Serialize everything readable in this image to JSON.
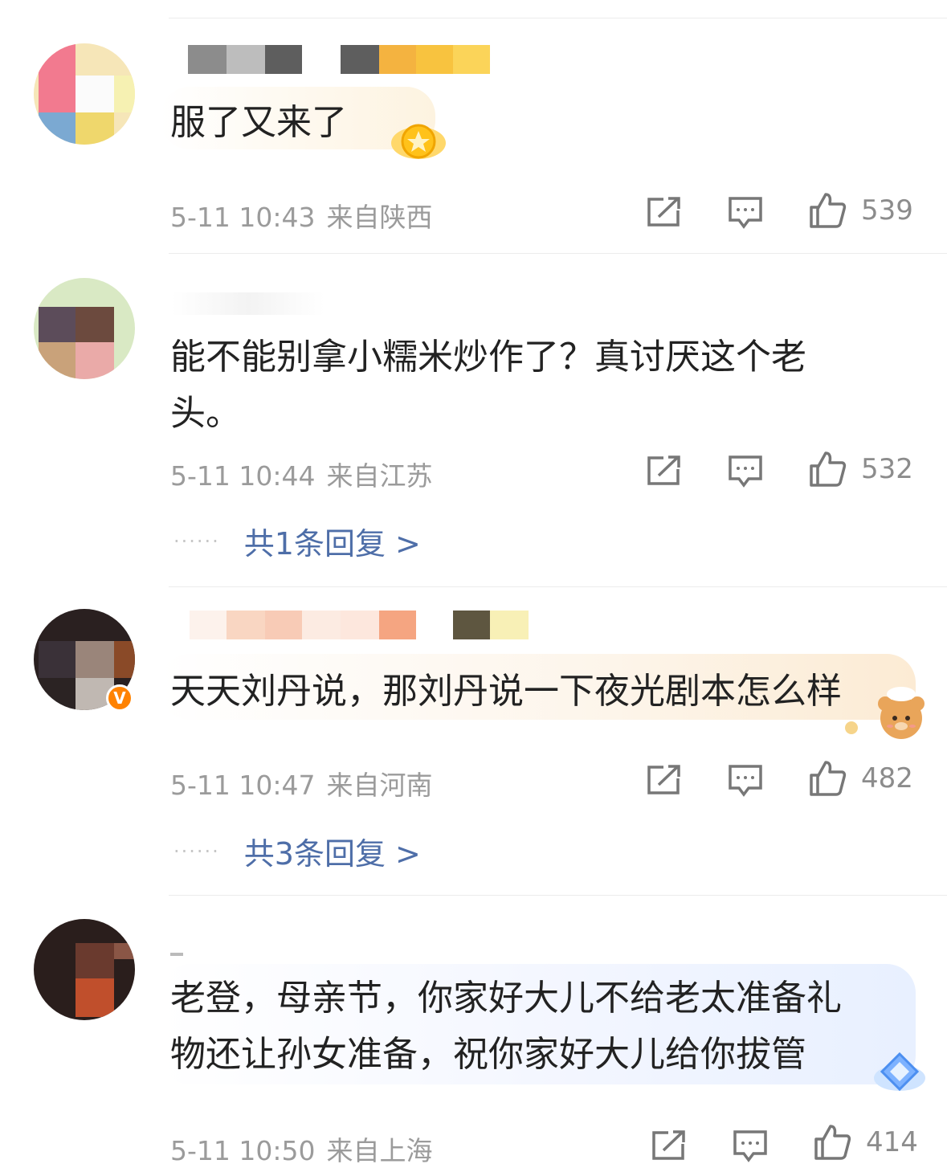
{
  "comments": [
    {
      "text": "服了又来了",
      "date": "5-11 10:43",
      "location": "来自陕西",
      "likes": "539",
      "sticker_icon": "star-badge-icon",
      "reply_link": null
    },
    {
      "text_line1": "能不能别拿小糯米炒作了？真讨厌这个老",
      "text_line2": "头。",
      "date": "5-11 10:44",
      "location": "来自江苏",
      "likes": "532",
      "reply_dots": "······",
      "reply_link": "共1条回复 >"
    },
    {
      "text": "天天刘丹说，那刘丹说一下夜光剧本怎么样",
      "date": "5-11 10:47",
      "location": "来自河南",
      "likes": "482",
      "verified_badge": "V",
      "sticker_icon": "bear-chef-icon",
      "reply_dots": "······",
      "reply_link": "共3条回复 >"
    },
    {
      "text_line1": "老登，母亲节，你家好大儿不给老太准备礼",
      "text_line2": "物还让孙女准备，祝你家好大儿给你拔管",
      "date": "5-11 10:50",
      "location": "来自上海",
      "likes": "414",
      "sticker_icon": "diamond-badge-icon"
    }
  ],
  "icons": {
    "share": "share-icon",
    "comment": "comment-icon",
    "like": "thumbs-up-icon"
  },
  "colors": {
    "link": "#4e6ea8",
    "meta": "#9b9b9b",
    "verified": "#ff8200"
  }
}
